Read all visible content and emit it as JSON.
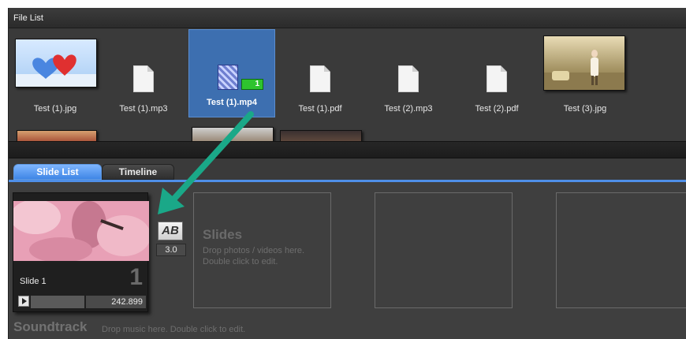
{
  "file_list": {
    "title": "File List",
    "files": [
      {
        "name": "Test (1).jpg",
        "type": "image",
        "icon": "hearts-image"
      },
      {
        "name": "Test (1).mp3",
        "type": "audio",
        "icon": "document-icon"
      },
      {
        "name": "Test (1).mp4",
        "type": "video",
        "icon": "video-icon",
        "selected": true,
        "badge": "1"
      },
      {
        "name": "Test (1).pdf",
        "type": "pdf",
        "icon": "document-icon"
      },
      {
        "name": "Test (2).mp3",
        "type": "audio",
        "icon": "document-icon"
      },
      {
        "name": "Test (2).pdf",
        "type": "pdf",
        "icon": "document-icon"
      },
      {
        "name": "Test (3).jpg",
        "type": "image",
        "icon": "photo-image"
      }
    ]
  },
  "tabs": {
    "slide_list": "Slide List",
    "timeline": "Timeline"
  },
  "slide": {
    "label": "Slide 1",
    "number": "1",
    "duration": "242.899"
  },
  "transition": {
    "icon_text": "AB",
    "duration": "3.0"
  },
  "placeholder": {
    "title": "Slides",
    "line1": "Drop photos / videos here.",
    "line2": "Double click to edit."
  },
  "soundtrack": {
    "title": "Soundtrack",
    "hint": "Drop music here.  Double click to edit."
  },
  "colors": {
    "accent": "#3f86e6",
    "selection": "#3d6fb0",
    "arrow": "#1aa888",
    "badge": "#2ec42e"
  }
}
